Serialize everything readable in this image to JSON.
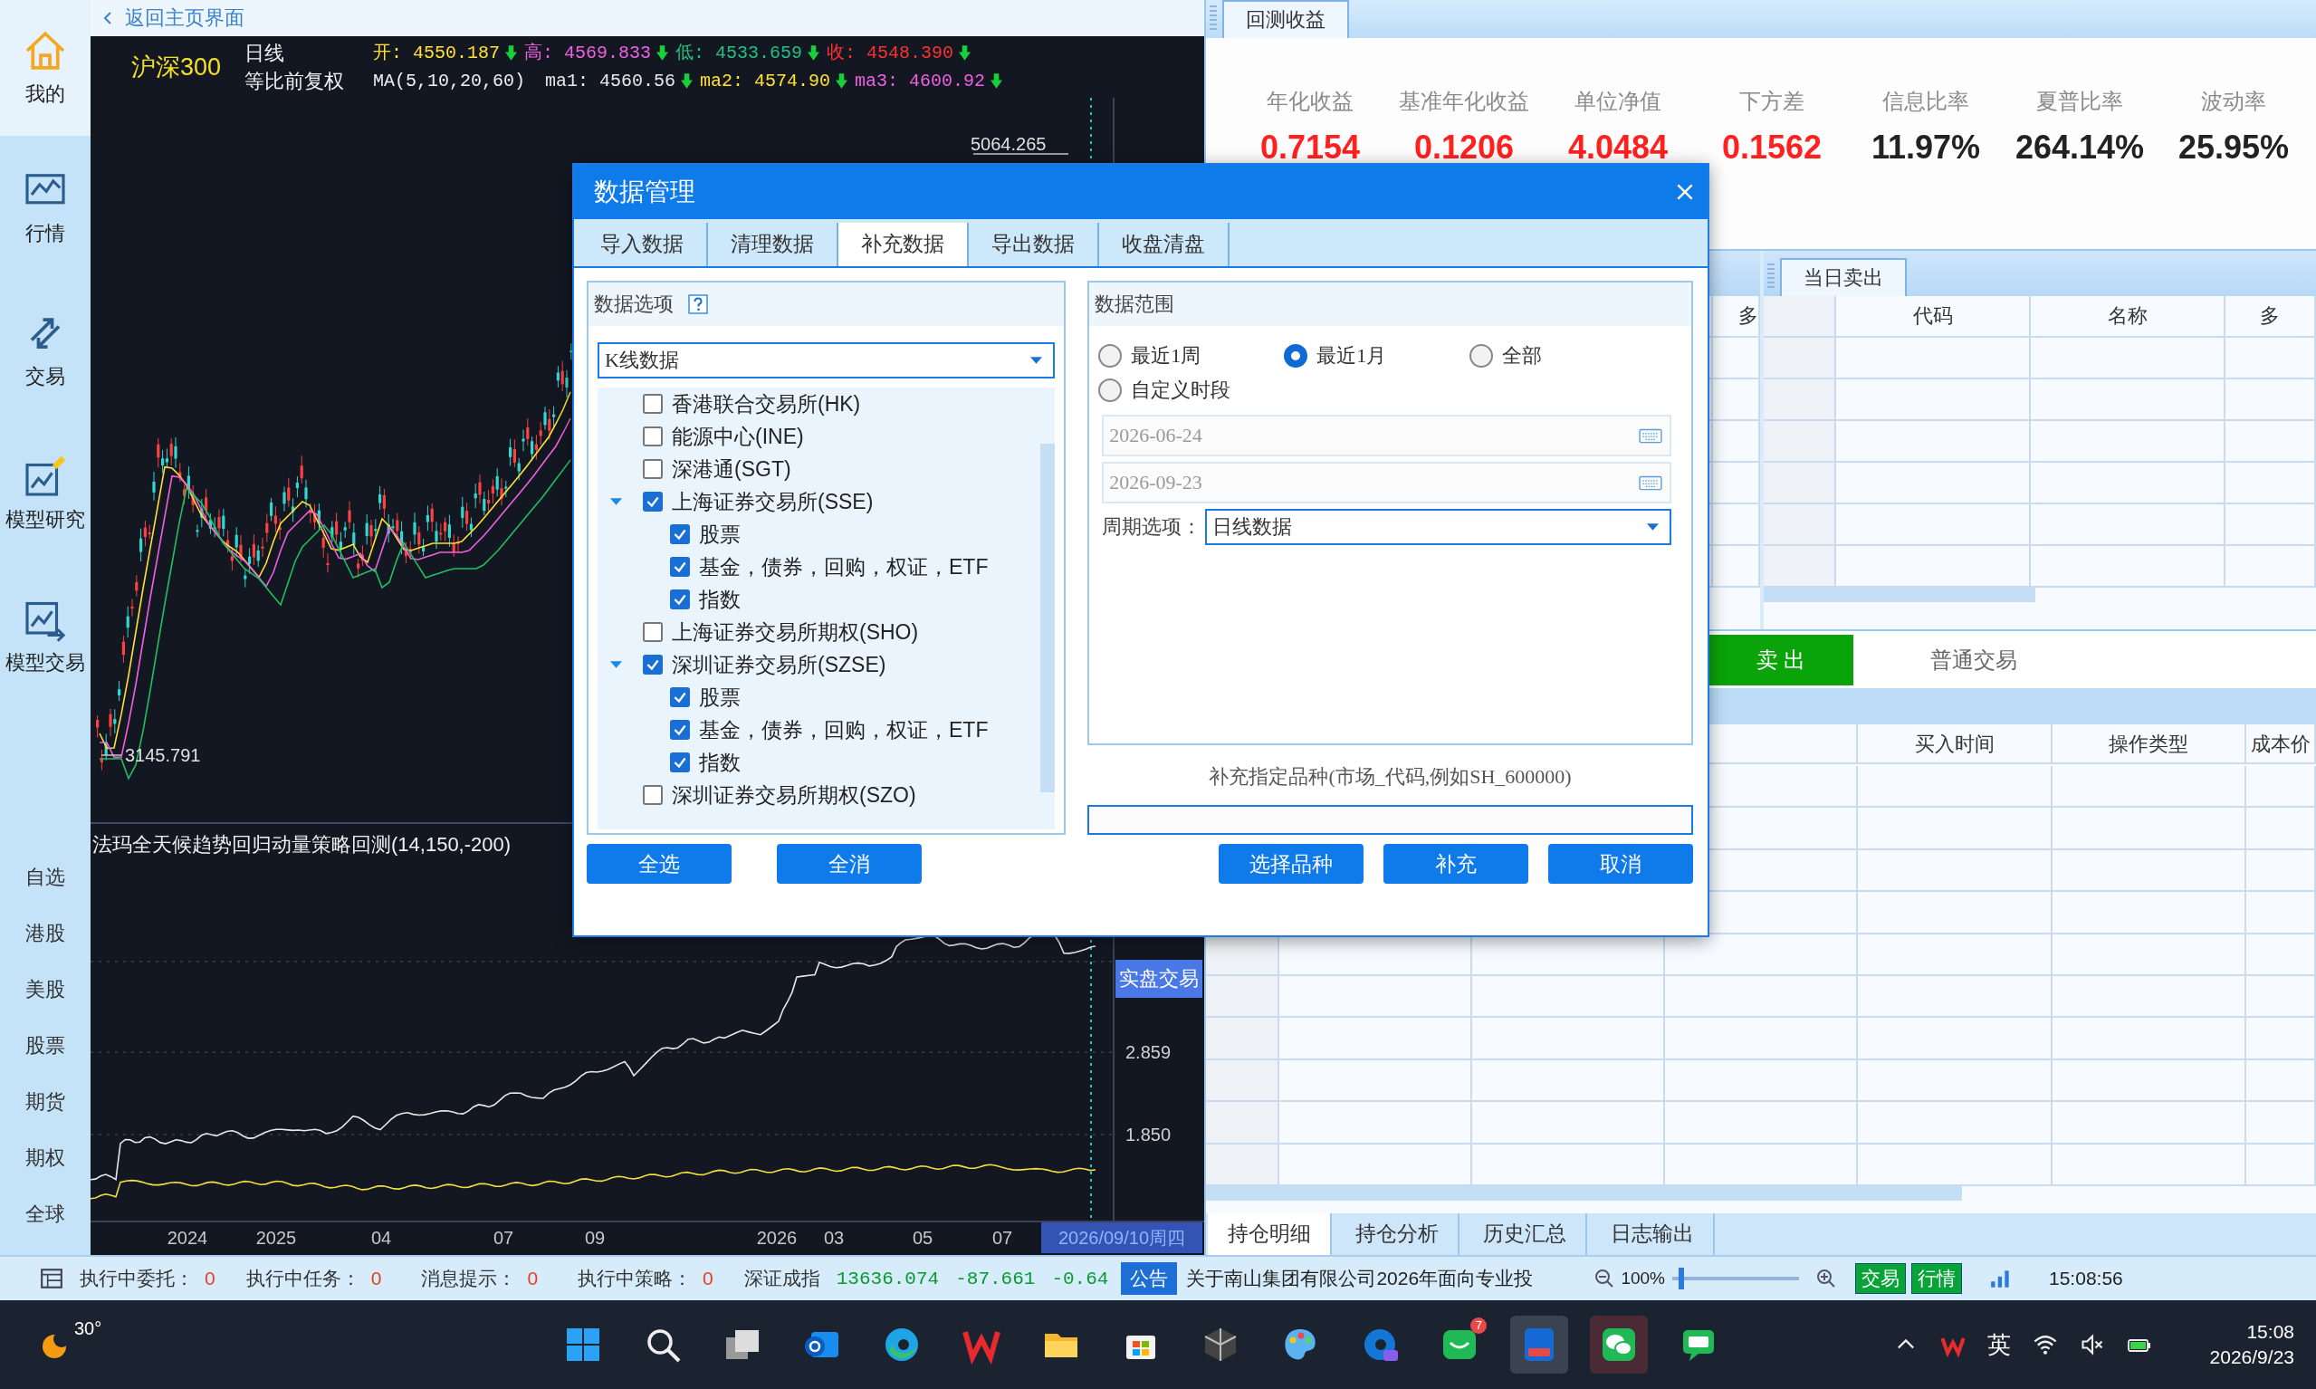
{
  "sidebar": {
    "nav": [
      {
        "label": "我的",
        "selected": true
      },
      {
        "label": "行情",
        "selected": false
      },
      {
        "label": "交易",
        "selected": false
      },
      {
        "label": "模型研究",
        "selected": false
      },
      {
        "label": "模型交易",
        "selected": false
      }
    ],
    "markets": [
      "自选",
      "港股",
      "美股",
      "股票",
      "期货",
      "期权",
      "全球"
    ]
  },
  "back_link": "返回主页界面",
  "chart": {
    "symbol": "沪深300",
    "period": "日线",
    "adjust": "等比前复权",
    "ohlc": [
      {
        "label": "开: ",
        "value": "4550.187",
        "color": "#ffe033"
      },
      {
        "label": "高: ",
        "value": "4569.833",
        "color": "#f060e0"
      },
      {
        "label": "低: ",
        "value": "4533.659",
        "color": "#20c080"
      },
      {
        "label": "收: ",
        "value": "4548.390",
        "color": "#ff3030"
      }
    ],
    "ma_label": "MA(5,10,20,60)",
    "mas": [
      {
        "label": "ma1: ",
        "value": "4560.56",
        "color": "#e8e8e8"
      },
      {
        "label": "ma2: ",
        "value": "4574.90",
        "color": "#ffe033"
      },
      {
        "label": "ma3: ",
        "value": "4600.92",
        "color": "#f060e0"
      }
    ],
    "high_label": "5064.265",
    "low_label": "3145.791",
    "strategy_title": "法玛全天候趋势回归动量策略回测(14,150,-200)",
    "y_labels": [
      "2.859",
      "1.850"
    ],
    "live_button": "实盘交易",
    "x_labels": [
      "2024",
      "2025",
      "04",
      "07",
      "09",
      "2026",
      "03",
      "05",
      "07"
    ],
    "date_marker": "2026/09/10周四"
  },
  "backtest": {
    "tab": "回测收益",
    "metrics": [
      {
        "label": "年化收益",
        "value": "0.7154",
        "color": "#ff2020"
      },
      {
        "label": "基准年化收益",
        "value": "0.1206",
        "color": "#ff2020"
      },
      {
        "label": "单位净值",
        "value": "4.0484",
        "color": "#ff2020"
      },
      {
        "label": "下方差",
        "value": "0.1562",
        "color": "#ff2020"
      },
      {
        "label": "信息比率",
        "value": "11.97%",
        "color": "#222222"
      },
      {
        "label": "夏普比率",
        "value": "264.14%",
        "color": "#222222"
      },
      {
        "label": "波动率",
        "value": "25.95%",
        "color": "#222222"
      }
    ]
  },
  "sell_panel": {
    "left_column": "多",
    "tab": "当日卖出",
    "columns": [
      "代码",
      "名称",
      "多"
    ],
    "sell_button": "卖 出",
    "trade_type": "普通交易"
  },
  "positions_table": {
    "columns": [
      "买入时间",
      "操作类型",
      "成本价"
    ]
  },
  "bottom_tabs": [
    {
      "label": "持仓明细",
      "selected": true
    },
    {
      "label": "持仓分析",
      "selected": false
    },
    {
      "label": "历史汇总",
      "selected": false
    },
    {
      "label": "日志输出",
      "selected": false
    }
  ],
  "status_bar": {
    "counters": [
      {
        "label": "执行中委托：",
        "value": "0"
      },
      {
        "label": "执行中任务：",
        "value": "0"
      },
      {
        "label": "消息提示：",
        "value": "0"
      },
      {
        "label": "执行中策略：",
        "value": "0"
      }
    ],
    "index_name": "深证成指",
    "index_values": [
      "13636.074",
      "-87.661",
      "-0.64"
    ],
    "notice_badge": "公告",
    "notice": "关于南山集团有限公司2026年面向专业投",
    "zoom": "100%",
    "zoom_slider": {
      "level": 0.05
    },
    "buttons": [
      "交易",
      "行情"
    ],
    "time": "15:08:56"
  },
  "dialog": {
    "title": "数据管理",
    "tabs": [
      {
        "label": "导入数据",
        "selected": false
      },
      {
        "label": "清理数据",
        "selected": false
      },
      {
        "label": "补充数据",
        "selected": true
      },
      {
        "label": "导出数据",
        "selected": false
      },
      {
        "label": "收盘清盘",
        "selected": false
      }
    ],
    "options_title": "数据选项",
    "data_type": "K线数据",
    "markets": [
      {
        "label": "香港联合交易所(HK)",
        "checked": false
      },
      {
        "label": "能源中心(INE)",
        "checked": false
      },
      {
        "label": "深港通(SGT)",
        "checked": false
      },
      {
        "label": "上海证券交易所(SSE)",
        "checked": true,
        "expanded": true,
        "children": [
          {
            "label": "股票",
            "checked": true
          },
          {
            "label": "基金，债券，回购，权证，ETF",
            "checked": true
          },
          {
            "label": "指数",
            "checked": true
          }
        ]
      },
      {
        "label": "上海证券交易所期权(SHO)",
        "checked": false
      },
      {
        "label": "深圳证券交易所(SZSE)",
        "checked": true,
        "expanded": true,
        "children": [
          {
            "label": "股票",
            "checked": true
          },
          {
            "label": "基金，债券，回购，权证，ETF",
            "checked": true
          },
          {
            "label": "指数",
            "checked": true
          }
        ]
      },
      {
        "label": "深圳证券交易所期权(SZO)",
        "checked": false
      }
    ],
    "range_title": "数据范围",
    "ranges": [
      {
        "label": "最近1周",
        "selected": false
      },
      {
        "label": "最近1月",
        "selected": true
      },
      {
        "label": "全部",
        "selected": false
      },
      {
        "label": "自定义时段",
        "selected": false
      }
    ],
    "start_date": "2026-06-24",
    "end_date": "2026-09-23",
    "period_label": "周期选项：",
    "period": "日线数据",
    "symbol_hint": "补充指定品种(市场_代码,例如SH_600000)",
    "left_buttons": [
      "全选",
      "全消"
    ],
    "right_buttons": [
      "选择品种",
      "补充",
      "取消"
    ]
  },
  "taskbar": {
    "weather": "30°",
    "chat_badge": "7",
    "ime": "英",
    "time": "15:08",
    "date": "2026/9/23"
  }
}
